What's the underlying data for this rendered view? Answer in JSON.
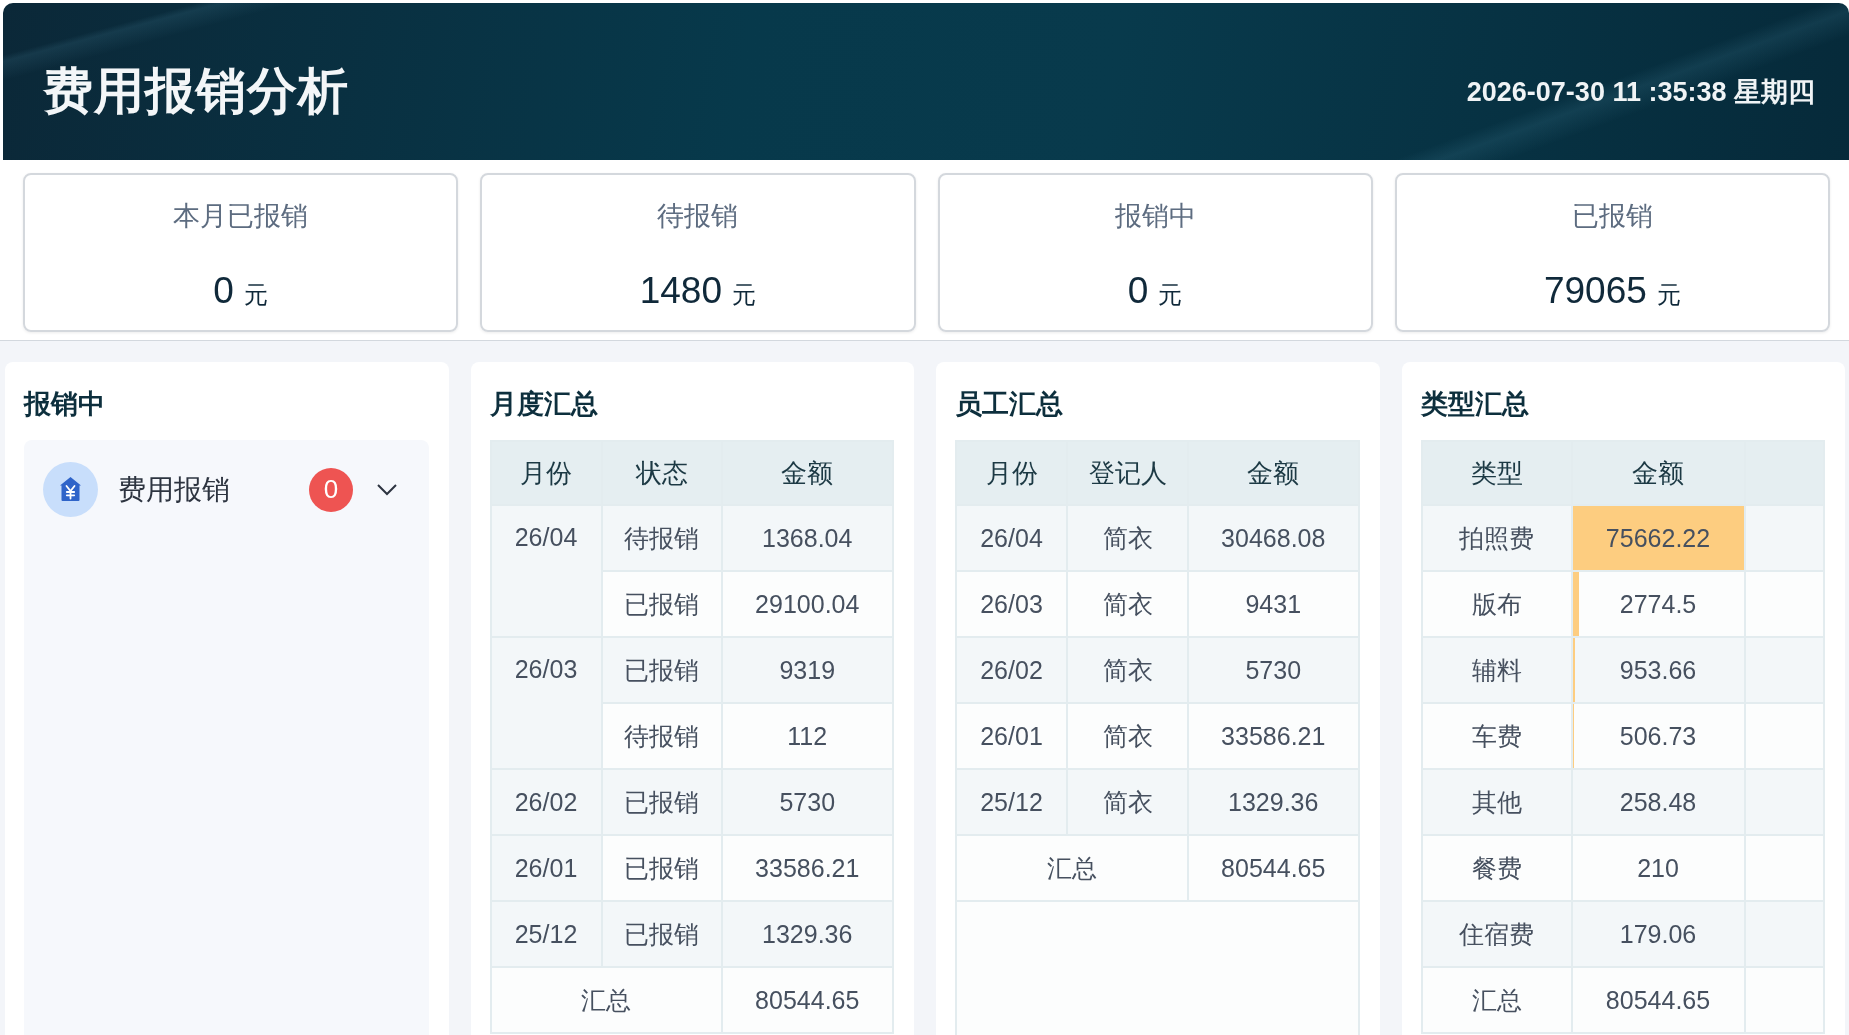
{
  "header": {
    "title": "费用报销分析",
    "datetime": "2026-07-30 11 :35:38 星期四"
  },
  "stat_cards": [
    {
      "label": "本月已报销",
      "value": "0",
      "unit": "元"
    },
    {
      "label": "待报销",
      "value": "1480",
      "unit": "元"
    },
    {
      "label": "报销中",
      "value": "0",
      "unit": "元"
    },
    {
      "label": "已报销",
      "value": "79065",
      "unit": "元"
    }
  ],
  "in_progress_panel": {
    "title": "报销中",
    "items": [
      {
        "label": "费用报销",
        "count": "0",
        "expanded": false
      }
    ]
  },
  "monthly_summary": {
    "title": "月度汇总",
    "columns": [
      "月份",
      "状态",
      "金额"
    ],
    "groups": [
      {
        "month": "26/04",
        "rows": [
          {
            "status": "待报销",
            "amount": "1368.04"
          },
          {
            "status": "已报销",
            "amount": "29100.04"
          }
        ]
      },
      {
        "month": "26/03",
        "rows": [
          {
            "status": "已报销",
            "amount": "9319"
          },
          {
            "status": "待报销",
            "amount": "112"
          }
        ]
      },
      {
        "month": "26/02",
        "rows": [
          {
            "status": "已报销",
            "amount": "5730"
          }
        ]
      },
      {
        "month": "26/01",
        "rows": [
          {
            "status": "已报销",
            "amount": "33586.21"
          }
        ]
      },
      {
        "month": "25/12",
        "rows": [
          {
            "status": "已报销",
            "amount": "1329.36"
          }
        ]
      }
    ],
    "total": {
      "label": "汇总",
      "amount": "80544.65"
    }
  },
  "employee_summary": {
    "title": "员工汇总",
    "columns": [
      "月份",
      "登记人",
      "金额"
    ],
    "rows": [
      {
        "month": "26/04",
        "registrant": "简衣",
        "amount": "30468.08"
      },
      {
        "month": "26/03",
        "registrant": "简衣",
        "amount": "9431"
      },
      {
        "month": "26/02",
        "registrant": "简衣",
        "amount": "5730"
      },
      {
        "month": "26/01",
        "registrant": "简衣",
        "amount": "33586.21"
      },
      {
        "month": "25/12",
        "registrant": "简衣",
        "amount": "1329.36"
      }
    ],
    "total": {
      "label": "汇总",
      "amount": "80544.65"
    }
  },
  "type_summary": {
    "title": "类型汇总",
    "columns": [
      "类型",
      "金额"
    ],
    "rows": [
      {
        "type": "拍照费",
        "amount": "75662.22",
        "level": 1
      },
      {
        "type": "版布",
        "amount": "2774.5",
        "level": 0.037
      },
      {
        "type": "辅料",
        "amount": "953.66",
        "level": 0.013
      },
      {
        "type": "车费",
        "amount": "506.73",
        "level": 0.007
      },
      {
        "type": "其他",
        "amount": "258.48"
      },
      {
        "type": "餐费",
        "amount": "210"
      },
      {
        "type": "住宿费",
        "amount": "179.06"
      }
    ],
    "total": {
      "label": "汇总",
      "amount": "80544.65"
    }
  }
}
